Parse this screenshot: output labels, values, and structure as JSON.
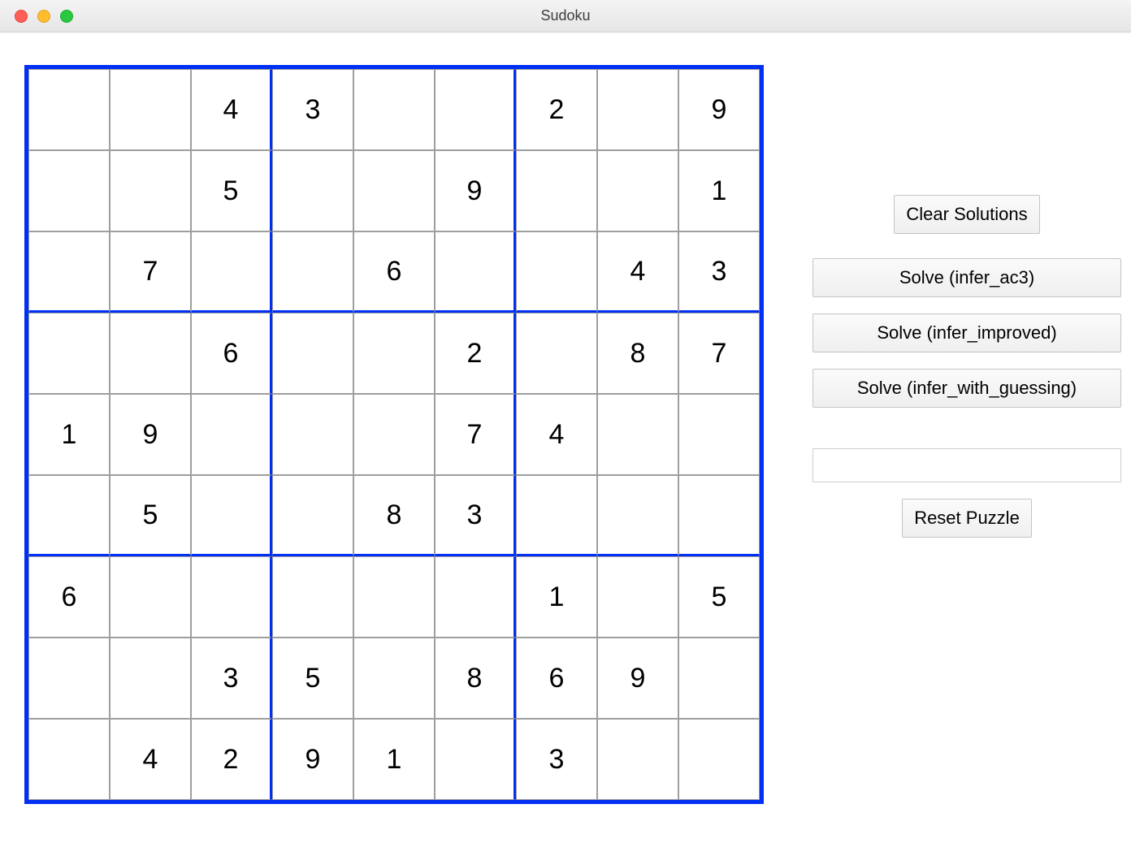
{
  "window": {
    "title": "Sudoku"
  },
  "sudoku": {
    "rows": [
      [
        "",
        "",
        "4",
        "3",
        "",
        "",
        "2",
        "",
        "9"
      ],
      [
        "",
        "",
        "5",
        "",
        "",
        "9",
        "",
        "",
        "1"
      ],
      [
        "",
        "7",
        "",
        "",
        "6",
        "",
        "",
        "4",
        "3"
      ],
      [
        "",
        "",
        "6",
        "",
        "",
        "2",
        "",
        "8",
        "7"
      ],
      [
        "1",
        "9",
        "",
        "",
        "",
        "7",
        "4",
        "",
        ""
      ],
      [
        "",
        "5",
        "",
        "",
        "8",
        "3",
        "",
        "",
        ""
      ],
      [
        "6",
        "",
        "",
        "",
        "",
        "",
        "1",
        "",
        "5"
      ],
      [
        "",
        "",
        "3",
        "5",
        "",
        "8",
        "6",
        "9",
        ""
      ],
      [
        "",
        "4",
        "2",
        "9",
        "1",
        "",
        "3",
        "",
        ""
      ]
    ]
  },
  "buttons": {
    "clear": "Clear Solutions",
    "solve_ac3": "Solve (infer_ac3)",
    "solve_improved": "Solve (infer_improved)",
    "solve_guessing": "Solve (infer_with_guessing)",
    "reset": "Reset Puzzle"
  },
  "input": {
    "value": ""
  }
}
